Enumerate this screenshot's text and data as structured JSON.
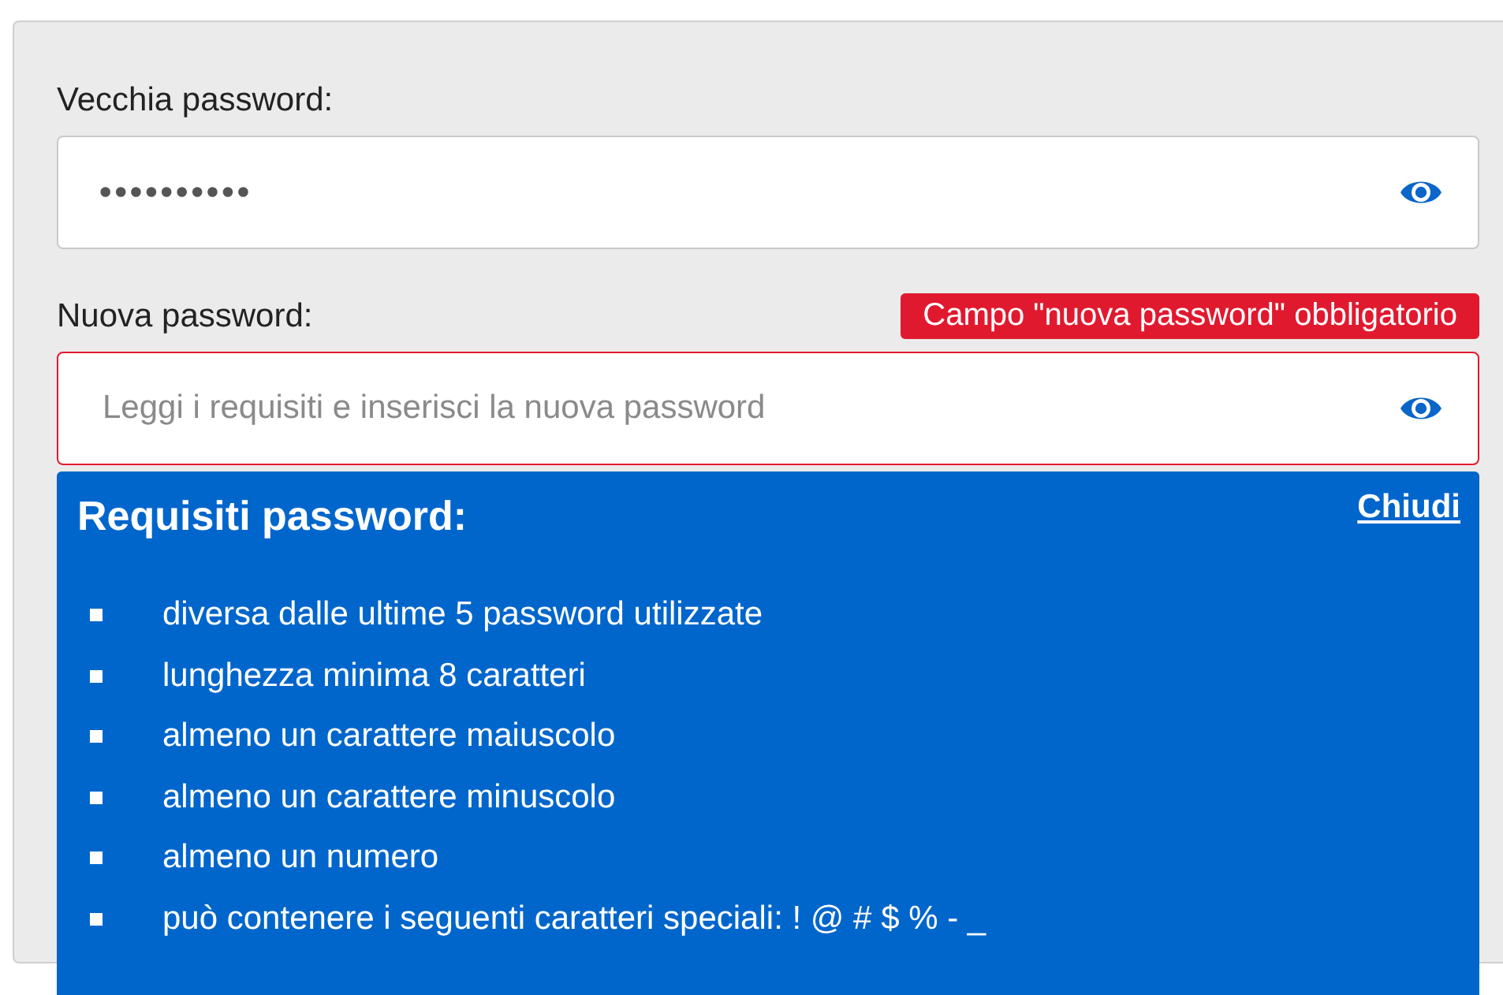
{
  "fields": [
    {
      "label": "Vecchia password:",
      "value": "••••••••••",
      "invalid": false
    },
    {
      "label": "Nuova password:",
      "placeholder": "Leggi i requisiti e inserisci la nuova password",
      "error": "Campo \"nuova password\" obbligatorio",
      "invalid": true
    }
  ],
  "requirements_popup": {
    "title": "Requisiti password:",
    "close_link": "Chiudi",
    "items": [
      "diversa dalle ultime 5 password utilizzate",
      "lunghezza minima 8 caratteri",
      "almeno un carattere maiuscolo",
      "almeno un carattere minuscolo",
      "almeno un numero",
      "può contenere i seguenti caratteri speciali: ! @ # $ % - _"
    ]
  }
}
